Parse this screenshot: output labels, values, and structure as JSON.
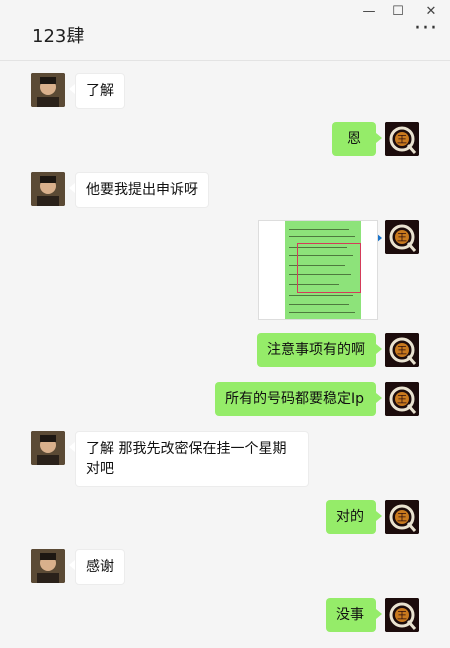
{
  "window": {
    "title": "123肆",
    "minimize_glyph": "—",
    "maximize_glyph": "☐",
    "close_glyph": "✕",
    "more_glyph": "···"
  },
  "avatars": {
    "friend_icon": "friend-photo-avatar",
    "me_icon": "me-logo-avatar",
    "me_letter": "Q",
    "me_char": "王"
  },
  "messages": [
    {
      "side": "left",
      "text": "了解"
    },
    {
      "side": "right",
      "text": "恩"
    },
    {
      "side": "left",
      "text": "他要我提出申诉呀"
    },
    {
      "side": "right",
      "type": "image",
      "text": ""
    },
    {
      "side": "right",
      "text": "注意事项有的啊"
    },
    {
      "side": "right",
      "text": "所有的号码都要稳定Ip"
    },
    {
      "side": "left",
      "text": "了解 那我先改密保在挂一个星期对吧"
    },
    {
      "side": "right",
      "text": "对的"
    },
    {
      "side": "left",
      "text": "感谢"
    },
    {
      "side": "right",
      "text": "没事"
    }
  ],
  "colors": {
    "bubble_me": "#95ec69",
    "bubble_friend": "#ffffff",
    "background": "#f5f5f5"
  }
}
